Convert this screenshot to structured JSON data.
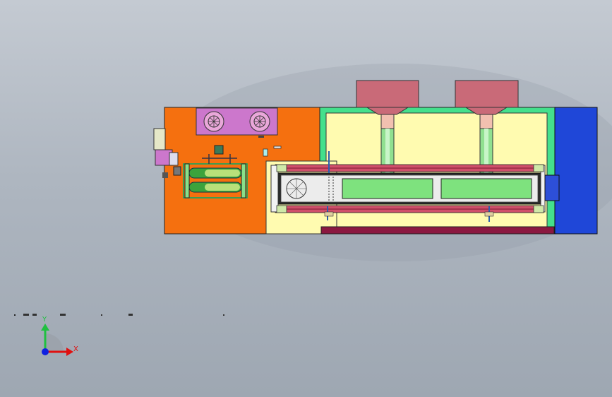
{
  "viewport": {
    "background_top": "#c4cad2",
    "background_bottom": "#9ea7b2"
  },
  "model": {
    "colors": {
      "orange_panel": "#f5700f",
      "cream_panel": "#fffbb0",
      "green_frame": "#44e08c",
      "blue_cover": "#1f47d8",
      "rose_hopper": "#c96a78",
      "maroon_base": "#8b1840",
      "magenta_fan_box": "#cc77cc",
      "light_green": "#7ee27e",
      "roller_green": "#3ca33c"
    },
    "components": [
      "fan-box",
      "motor-assembly",
      "roller-assembly",
      "conveyor-belt",
      "hopper-left",
      "hopper-right",
      "side-cover"
    ]
  },
  "triad": {
    "x_label": "X",
    "y_label": "Y",
    "x_color": "#e01010",
    "y_color": "#20c040",
    "origin_color": "#1020e0"
  }
}
